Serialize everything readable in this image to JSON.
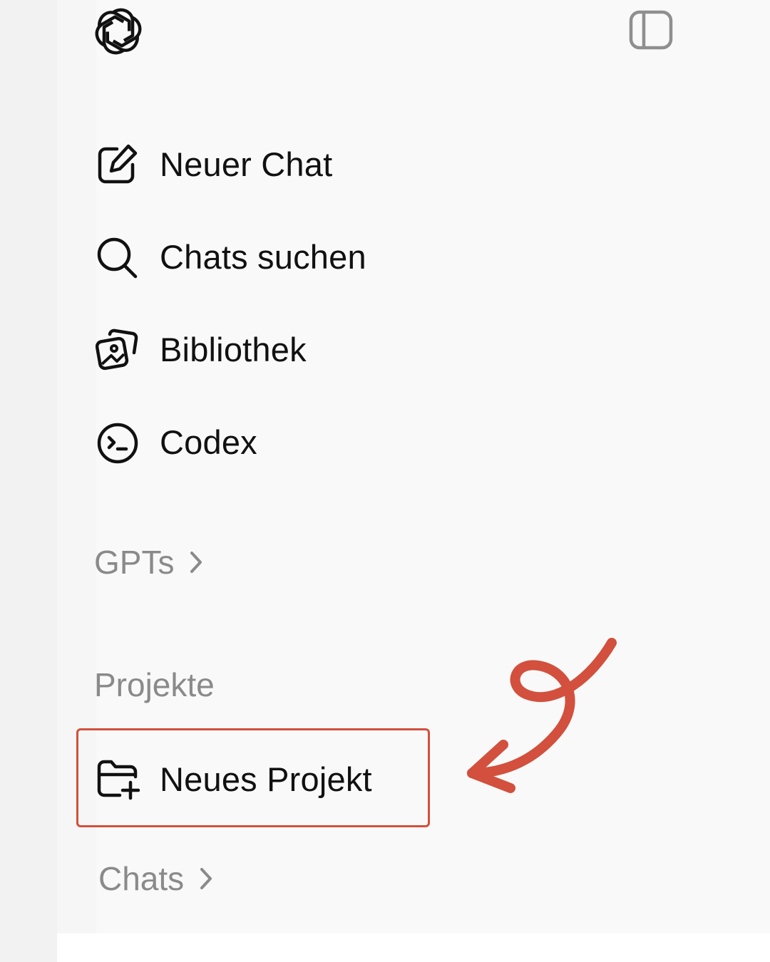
{
  "sidebar": {
    "logo_icon": "openai-logo-icon",
    "toggle_icon": "sidebar-toggle-icon",
    "items": [
      {
        "icon": "edit-icon",
        "label": "Neuer Chat"
      },
      {
        "icon": "search-icon",
        "label": "Chats suchen"
      },
      {
        "icon": "library-icon",
        "label": "Bibliothek"
      },
      {
        "icon": "codex-icon",
        "label": "Codex"
      }
    ],
    "gpts": {
      "label": "GPTs",
      "icon": "chevron-right-icon"
    },
    "projects": {
      "heading": "Projekte",
      "new_project": {
        "icon": "folder-plus-icon",
        "label": "Neues Projekt"
      }
    },
    "chats": {
      "label": "Chats",
      "icon": "chevron-right-icon"
    }
  },
  "annotation": {
    "highlight_color": "#d2503d",
    "arrow_color": "#d2503d"
  },
  "colors": {
    "background": "#f9f9f9",
    "text": "#111111",
    "muted_text": "#8a8a8a"
  }
}
